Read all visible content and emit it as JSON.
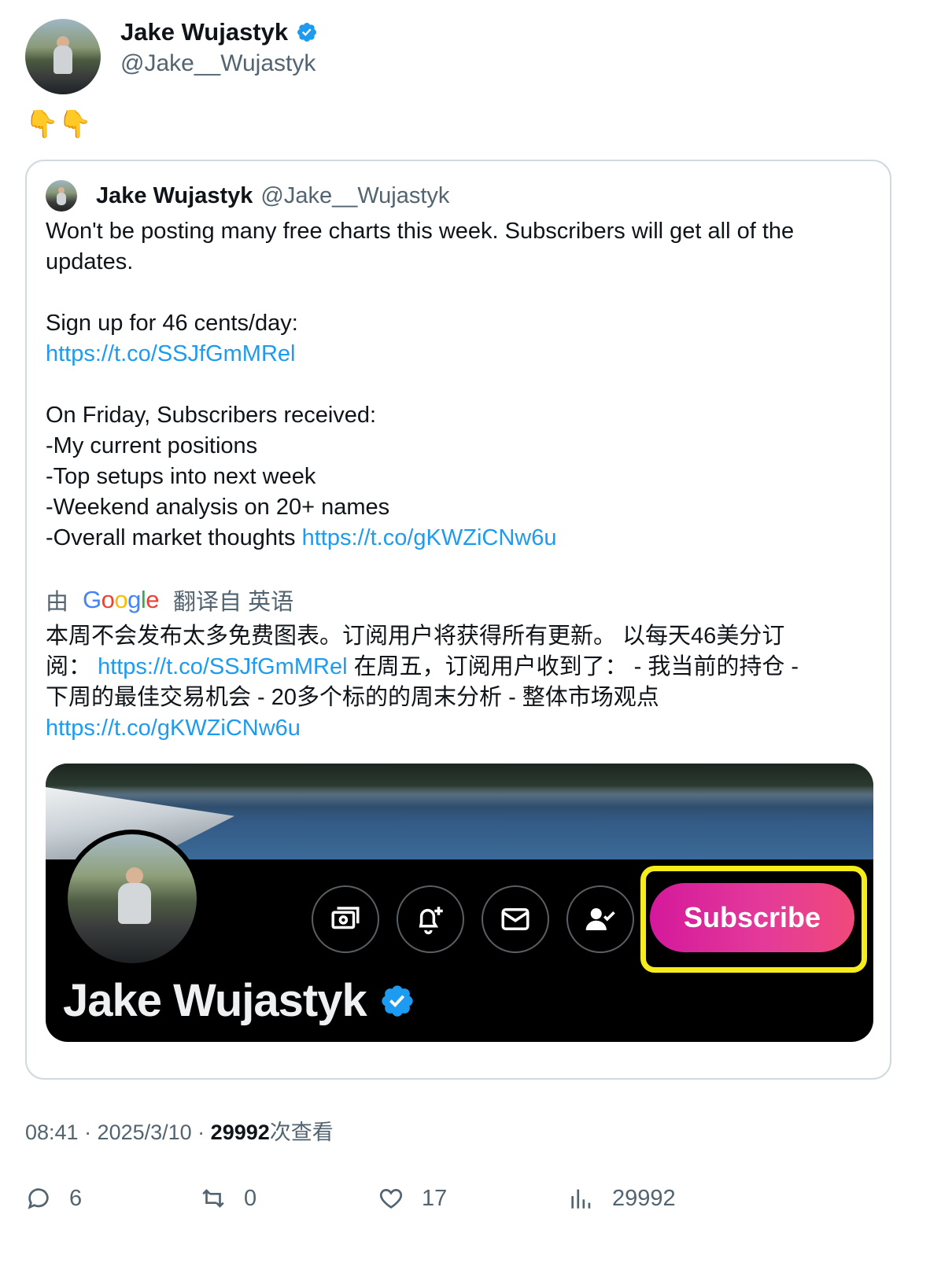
{
  "tweet": {
    "author": {
      "name": "Jake Wujastyk",
      "handle": "@Jake__Wujastyk"
    },
    "text": "👇👇",
    "timestamp": "08:41 · 2025/3/10 · ",
    "views_count": "29992",
    "views_suffix": "次查看"
  },
  "quoted": {
    "author_name": "Jake Wujastyk",
    "author_handle": "@Jake__Wujastyk",
    "line1": "Won't be posting many free charts this week. Subscribers will get all of the",
    "line2": "updates.",
    "line3": "Sign up for 46 cents/day:",
    "link1": "https://t.co/SSJfGmMRel",
    "line4": "On Friday, Subscribers received:",
    "line5": "-My current positions",
    "line6": "-Top setups into next week",
    "line7": "-Weekend analysis on 20+ names",
    "line8": "-Overall market thoughts ",
    "link2": "https://t.co/gKWZiCNw6u",
    "translation": {
      "by": "由",
      "google": "Google",
      "from": "翻译自 英语",
      "t1": "本周不会发布太多免费图表。订阅用户将获得所有更新。 以每天46美分订",
      "t2a": "阅： ",
      "t2link": "https://t.co/SSJfGmMRel",
      "t2b": " 在周五，订阅用户收到了： - 我当前的持仓 -",
      "t3": "下周的最佳交易机会 - 20多个标的的周末分析 - 整体市场观点",
      "t4link": "https://t.co/gKWZiCNw6u"
    },
    "media": {
      "subscribe_label": "Subscribe",
      "profile_name": "Jake Wujastyk",
      "highlight_color": "#f5ec1a"
    }
  },
  "stats": {
    "replies": "6",
    "retweets": "0",
    "likes": "17",
    "views": "29992"
  },
  "colors": {
    "link": "#1d9bf0",
    "verified": "#1d9bf0",
    "muted": "#536471"
  }
}
